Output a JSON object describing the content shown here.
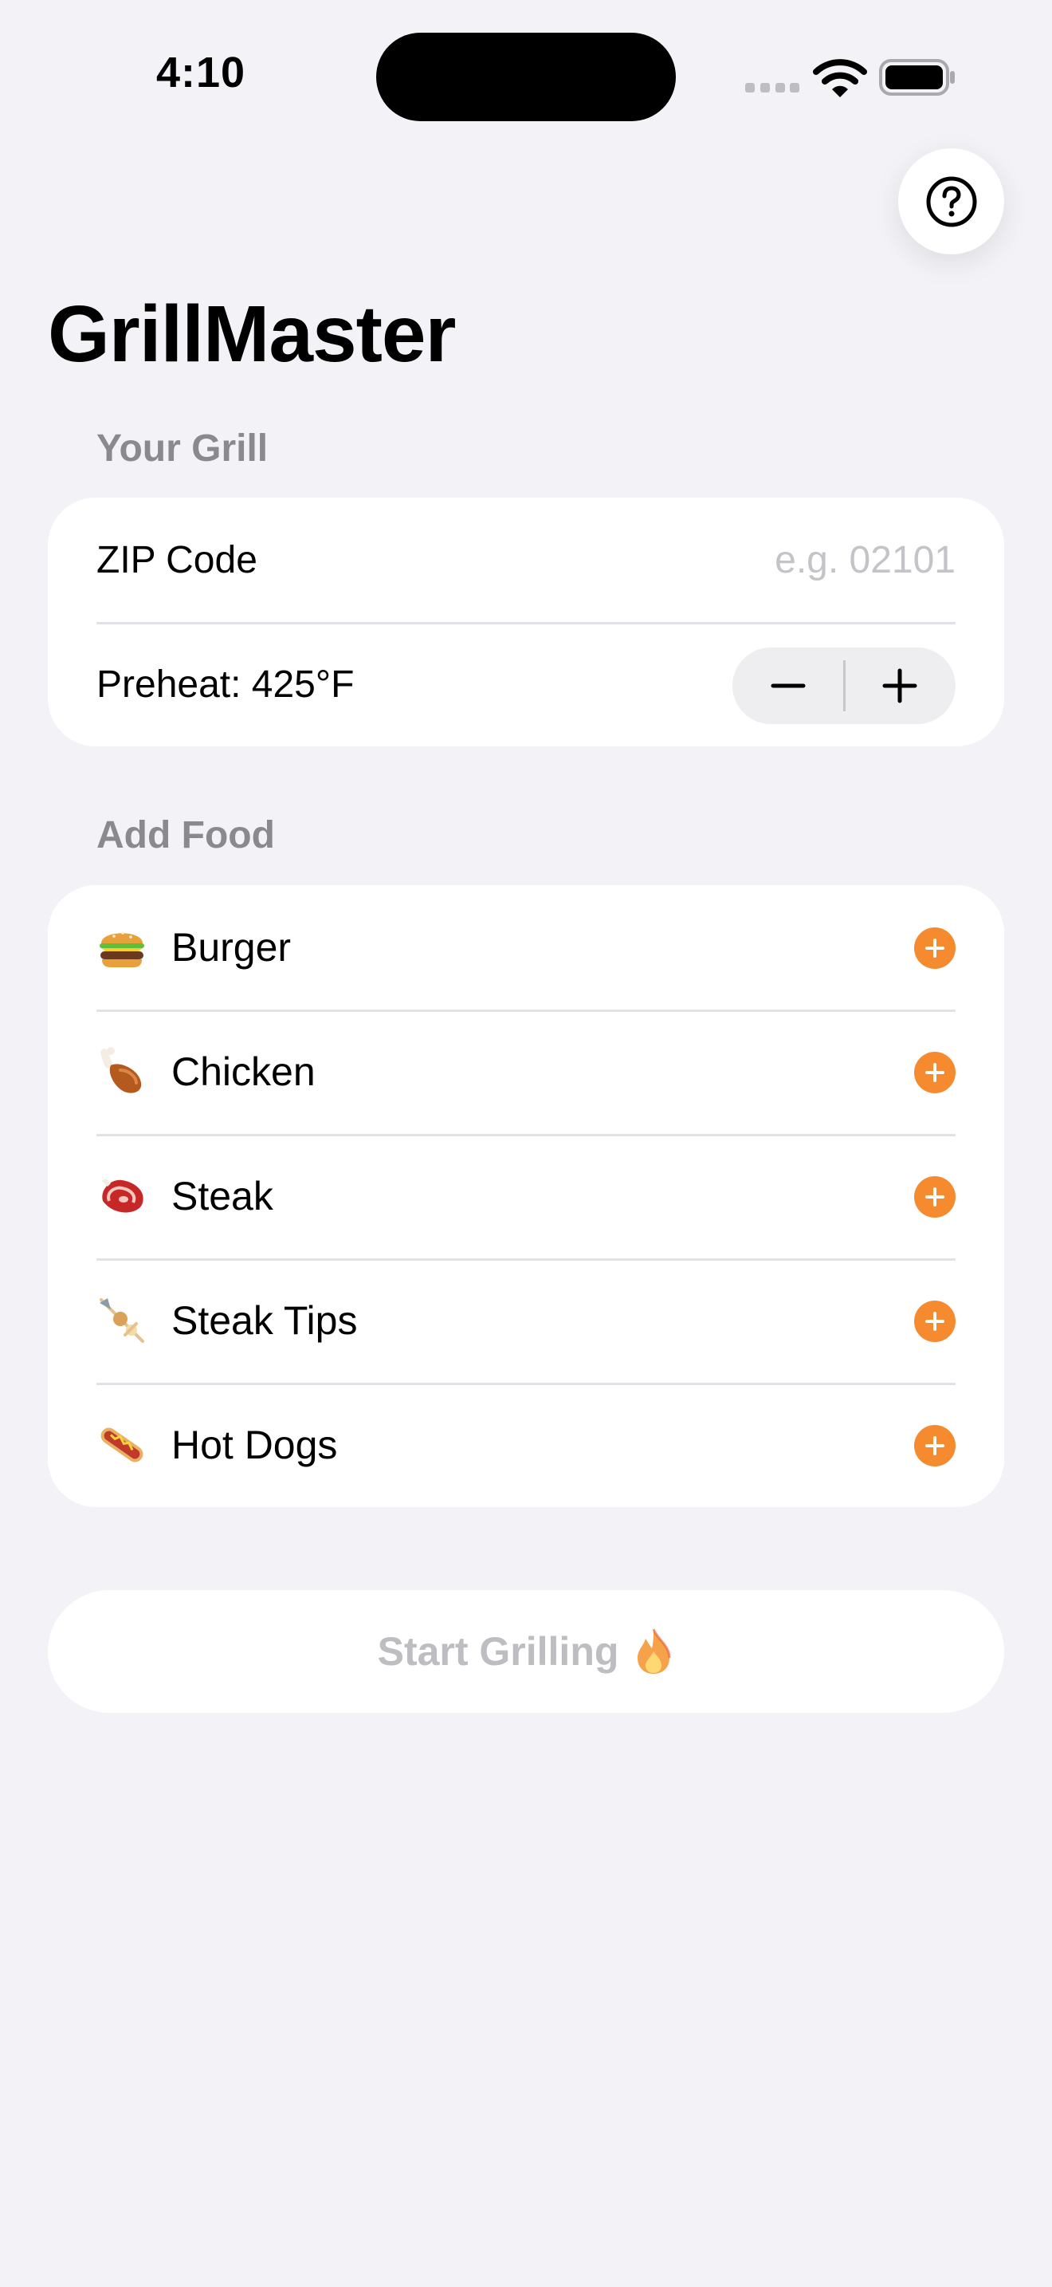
{
  "status_bar": {
    "time": "4:10"
  },
  "header": {
    "help_icon": "question-circle-icon",
    "title": "GrillMaster"
  },
  "grill_section": {
    "header": "Your Grill",
    "zip": {
      "label": "ZIP Code",
      "value": "",
      "placeholder": "e.g. 02101"
    },
    "preheat": {
      "label": "Preheat: 425°F",
      "decrement_icon": "minus-icon",
      "increment_icon": "plus-icon"
    }
  },
  "food_section": {
    "header": "Add Food",
    "items": [
      {
        "name": "Burger",
        "icon": "burger-icon"
      },
      {
        "name": "Chicken",
        "icon": "chicken-leg-icon"
      },
      {
        "name": "Steak",
        "icon": "steak-icon"
      },
      {
        "name": "Steak Tips",
        "icon": "skewer-icon"
      },
      {
        "name": "Hot Dogs",
        "icon": "hot-dog-icon"
      }
    ],
    "add_icon": "plus-circle-icon"
  },
  "start_button": {
    "label": "Start Grilling",
    "icon": "fire-icon",
    "enabled": false
  },
  "colors": {
    "background": "#F2F2F7",
    "accent": "#F58A2F",
    "section_header": "#8A8A8E",
    "disabled_text": "#BDBDC2"
  }
}
